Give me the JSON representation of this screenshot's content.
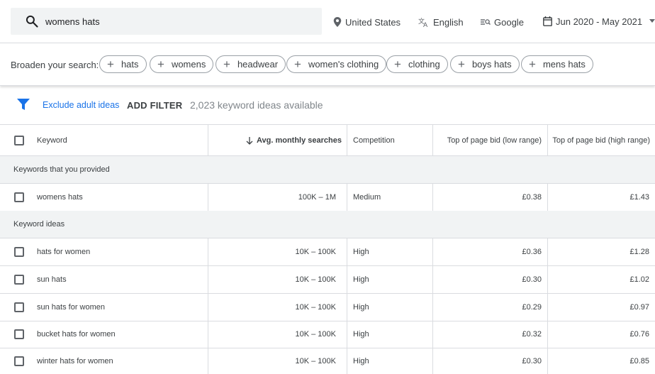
{
  "search": {
    "query": "womens hats"
  },
  "topbar": {
    "location": "United States",
    "language": "English",
    "network": "Google",
    "date_range": "Jun 2020 - May 2021"
  },
  "broaden": {
    "label": "Broaden your search:",
    "chips": [
      "hats",
      "womens",
      "headwear",
      "women's clothing",
      "clothing",
      "boys hats",
      "mens hats"
    ]
  },
  "filters": {
    "exclude_adult": "Exclude adult ideas",
    "add_filter": "ADD FILTER",
    "available": "2,023 keyword ideas available"
  },
  "table": {
    "headers": {
      "keyword": "Keyword",
      "avg": "Avg. monthly searches",
      "competition": "Competition",
      "low_bid": "Top of page bid (low range)",
      "high_bid": "Top of page bid (high range)"
    },
    "sections": {
      "provided": "Keywords that you provided",
      "ideas": "Keyword ideas"
    },
    "provided_rows": [
      {
        "keyword": "womens hats",
        "avg": "100K – 1M",
        "competition": "Medium",
        "low": "£0.38",
        "high": "£1.43"
      }
    ],
    "idea_rows": [
      {
        "keyword": "hats for women",
        "avg": "10K – 100K",
        "competition": "High",
        "low": "£0.36",
        "high": "£1.28"
      },
      {
        "keyword": "sun hats",
        "avg": "10K – 100K",
        "competition": "High",
        "low": "£0.30",
        "high": "£1.02"
      },
      {
        "keyword": "sun hats for women",
        "avg": "10K – 100K",
        "competition": "High",
        "low": "£0.29",
        "high": "£0.97"
      },
      {
        "keyword": "bucket hats for women",
        "avg": "10K – 100K",
        "competition": "High",
        "low": "£0.32",
        "high": "£0.76"
      },
      {
        "keyword": "winter hats for women",
        "avg": "10K – 100K",
        "competition": "High",
        "low": "£0.30",
        "high": "£0.85"
      }
    ]
  },
  "colors": {
    "accent": "#1a73e8",
    "border": "#dadce0",
    "section_bg": "#f1f3f4"
  }
}
